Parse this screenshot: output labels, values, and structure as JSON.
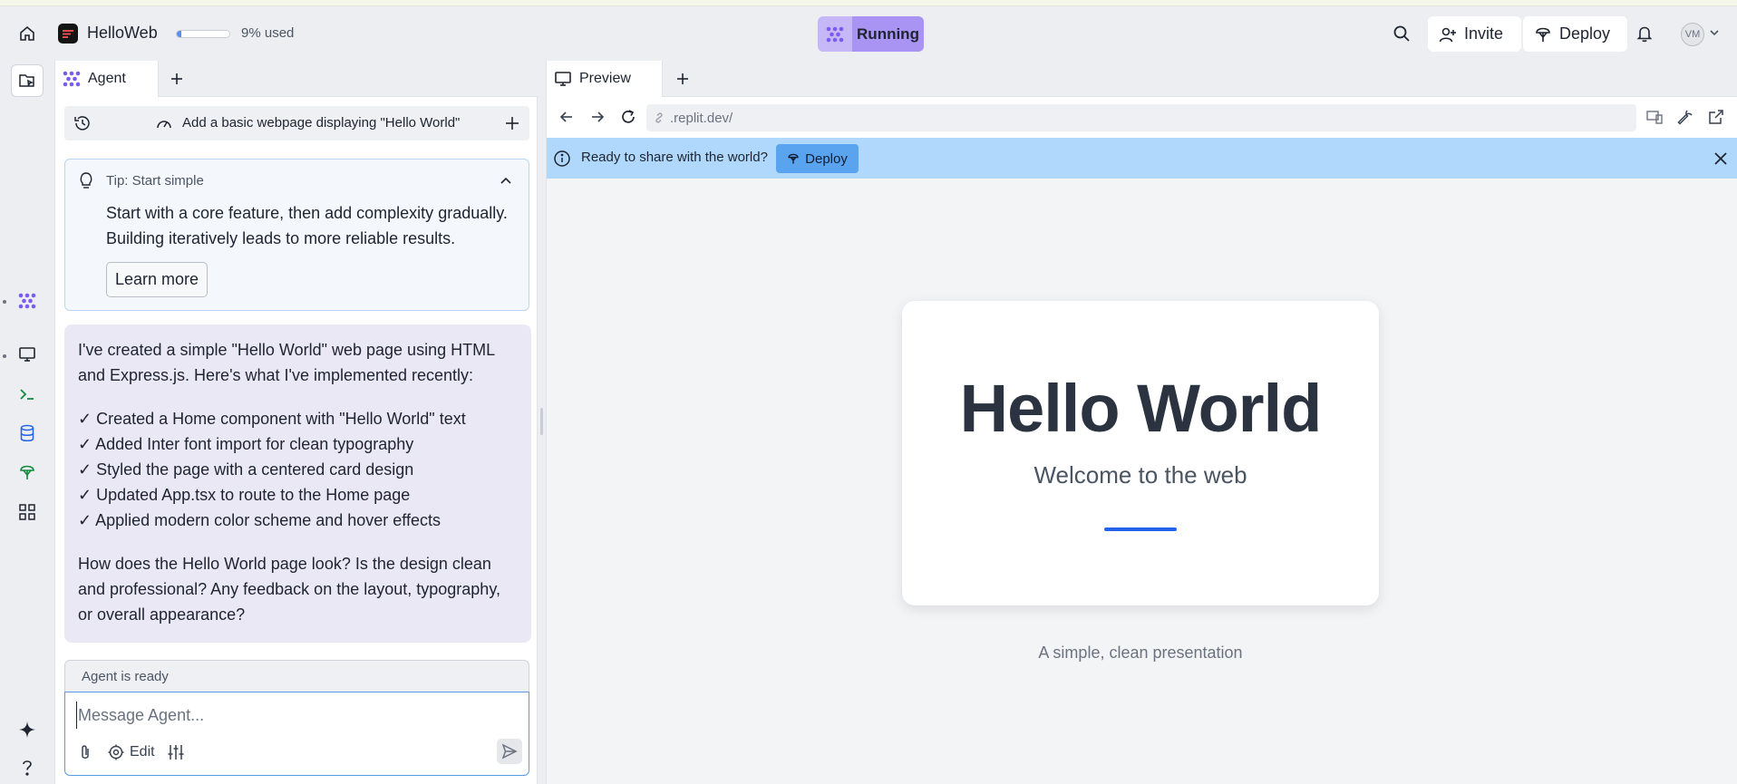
{
  "topbar": {
    "app_name": "HelloWeb",
    "usage_text": "9% used",
    "usage_fraction": 0.09,
    "run_status": "Running",
    "invite_label": "Invite",
    "deploy_label": "Deploy",
    "avatar_initials": "VM"
  },
  "agent": {
    "tab_label": "Agent",
    "chat_title": "Add a basic webpage displaying \"Hello World\"",
    "tip": {
      "title": "Tip: Start simple",
      "body": "Start with a core feature, then add complexity gradually. Building iteratively leads to more reliable results.",
      "button": "Learn more"
    },
    "message": {
      "intro": "I've created a simple \"Hello World\" web page using HTML and Express.js. Here's what I've implemented recently:",
      "items": [
        "✓ Created a Home component with \"Hello World\" text",
        "✓ Added Inter font import for clean typography",
        "✓ Styled the page with a centered card design",
        "✓ Updated App.tsx to route to the Home page",
        "✓ Applied modern color scheme and hover effects"
      ],
      "question": "How does the Hello World page look? Is the design clean and professional? Any feedback on the layout, typography, or overall appearance?"
    },
    "status": "Agent is ready",
    "input_placeholder": "Message Agent...",
    "edit_label": "Edit"
  },
  "preview": {
    "tab_label": "Preview",
    "url": ".replit.dev/",
    "banner_text": "Ready to share with the world?",
    "banner_deploy": "Deploy",
    "card_title": "Hello World",
    "card_subtitle": "Welcome to the web",
    "footer_text": "A simple, clean presentation"
  },
  "colors": {
    "accent": "#2563eb",
    "agent_purple": "#a994f4",
    "banner_blue": "#b0d8fc"
  }
}
